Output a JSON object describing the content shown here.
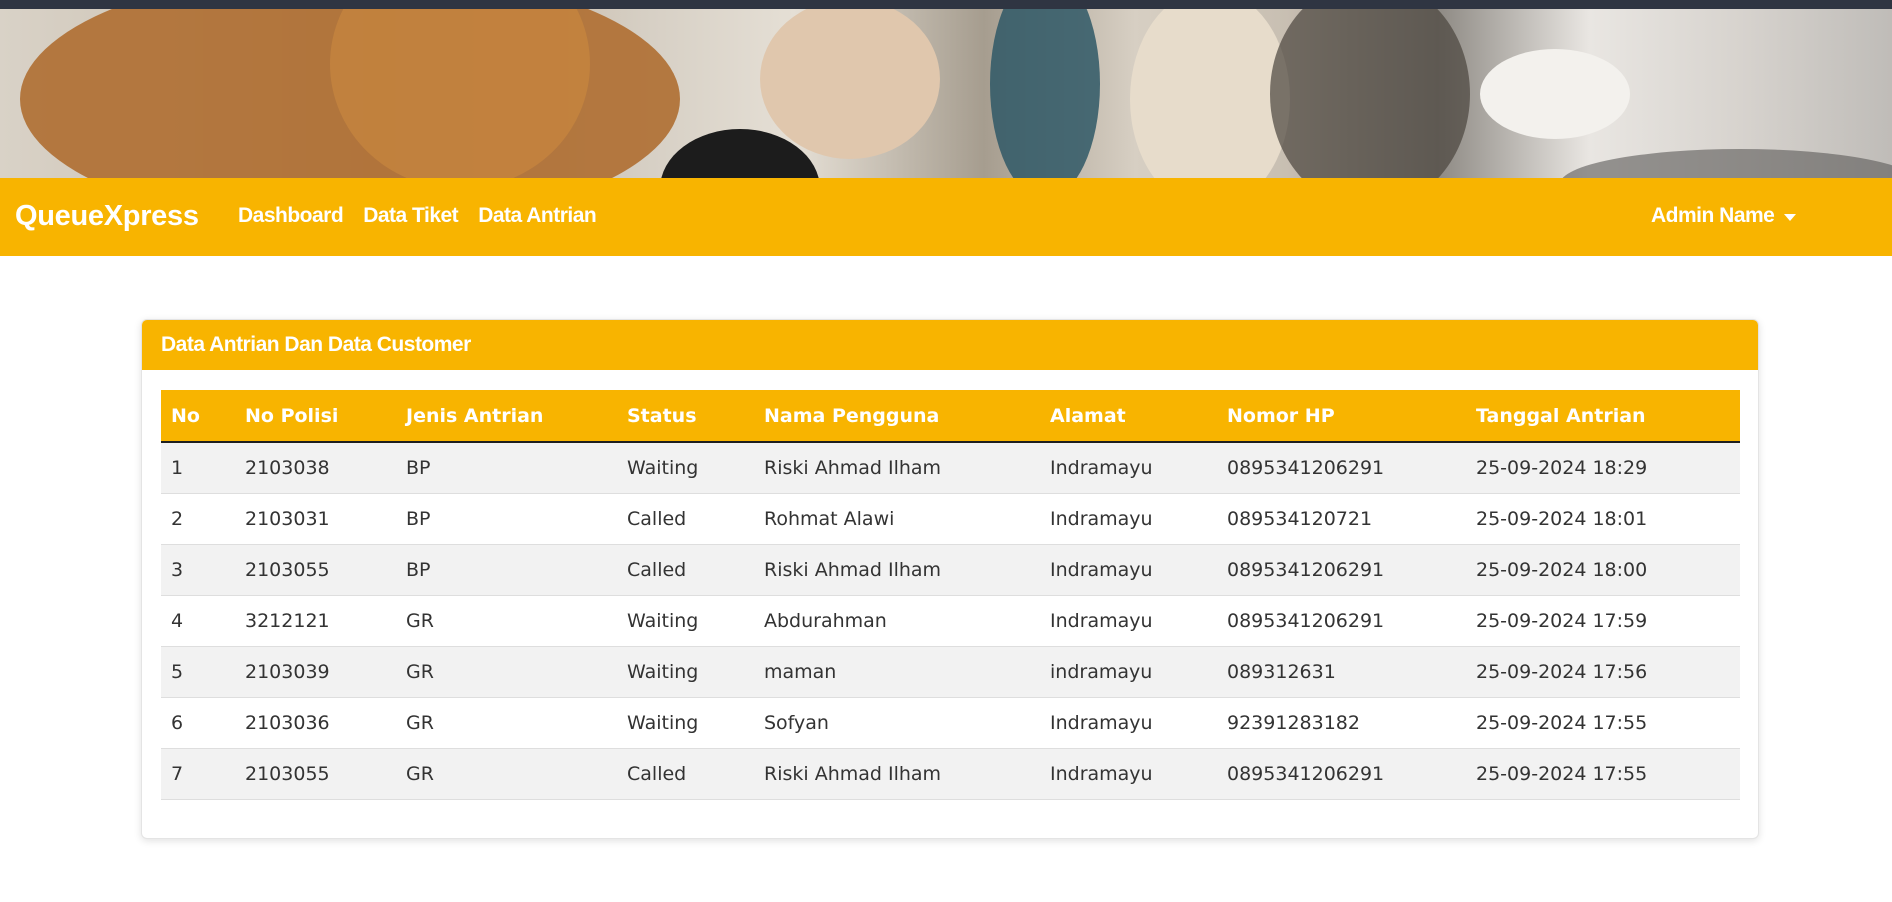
{
  "navbar": {
    "brand": "QueueXpress",
    "links": [
      "Dashboard",
      "Data Tiket",
      "Data Antrian"
    ],
    "user": "Admin Name"
  },
  "card": {
    "title": "Data Antrian Dan Data Customer"
  },
  "table": {
    "headers": [
      "No",
      "No Polisi",
      "Jenis Antrian",
      "Status",
      "Nama Pengguna",
      "Alamat",
      "Nomor HP",
      "Tanggal Antrian"
    ],
    "rows": [
      [
        "1",
        "2103038",
        "BP",
        "Waiting",
        "Riski Ahmad Ilham",
        "Indramayu",
        "0895341206291",
        "25-09-2024 18:29"
      ],
      [
        "2",
        "2103031",
        "BP",
        "Called",
        "Rohmat Alawi",
        "Indramayu",
        "089534120721",
        "25-09-2024 18:01"
      ],
      [
        "3",
        "2103055",
        "BP",
        "Called",
        "Riski Ahmad Ilham",
        "Indramayu",
        "0895341206291",
        "25-09-2024 18:00"
      ],
      [
        "4",
        "3212121",
        "GR",
        "Waiting",
        "Abdurahman",
        "Indramayu",
        "0895341206291",
        "25-09-2024 17:59"
      ],
      [
        "5",
        "2103039",
        "GR",
        "Waiting",
        "maman",
        "indramayu",
        "089312631",
        "25-09-2024 17:56"
      ],
      [
        "6",
        "2103036",
        "GR",
        "Waiting",
        "Sofyan",
        "Indramayu",
        "92391283182",
        "25-09-2024 17:55"
      ],
      [
        "7",
        "2103055",
        "GR",
        "Called",
        "Riski Ahmad Ilham",
        "Indramayu",
        "0895341206291",
        "25-09-2024 17:55"
      ]
    ]
  },
  "colors": {
    "accent": "#f8b400",
    "topbar": "#2f3542"
  },
  "icons": {
    "user_dropdown": "caret-down-icon"
  }
}
